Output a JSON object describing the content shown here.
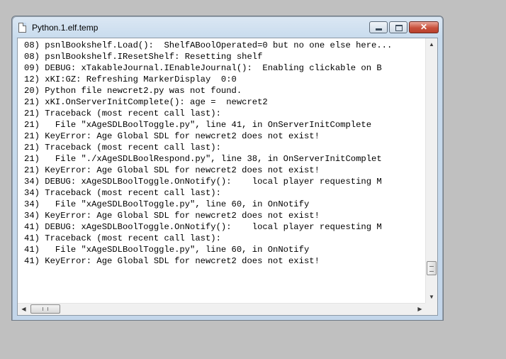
{
  "window": {
    "title": "Python.1.elf.temp",
    "close_glyph": "✕"
  },
  "log_lines": [
    "08) psnlBookshelf.Load():  ShelfABoolOperated=0 but no one else here...",
    "08) psnlBookshelf.IResetShelf: Resetting shelf",
    "09) DEBUG: xTakableJournal.IEnableJournal():  Enabling clickable on B",
    "12) xKI:GZ: Refreshing MarkerDisplay  0:0",
    "20) Python file newcret2.py was not found.",
    "21) xKI.OnServerInitComplete(): age =  newcret2",
    "21) Traceback (most recent call last):",
    "21)   File \"xAgeSDLBoolToggle.py\", line 41, in OnServerInitComplete",
    "21) KeyError: Age Global SDL for newcret2 does not exist!",
    "21) Traceback (most recent call last):",
    "21)   File \"./xAgeSDLBoolRespond.py\", line 38, in OnServerInitComplet",
    "21) KeyError: Age Global SDL for newcret2 does not exist!",
    "34) DEBUG: xAgeSDLBoolToggle.OnNotify():    local player requesting M",
    "34) Traceback (most recent call last):",
    "34)   File \"xAgeSDLBoolToggle.py\", line 60, in OnNotify",
    "34) KeyError: Age Global SDL for newcret2 does not exist!",
    "41) DEBUG: xAgeSDLBoolToggle.OnNotify():    local player requesting M",
    "41) Traceback (most recent call last):",
    "41)   File \"xAgeSDLBoolToggle.py\", line 60, in OnNotify",
    "41) KeyError: Age Global SDL for newcret2 does not exist!"
  ],
  "scrollbars": {
    "up": "▲",
    "down": "▼",
    "left": "◀",
    "right": "▶"
  }
}
